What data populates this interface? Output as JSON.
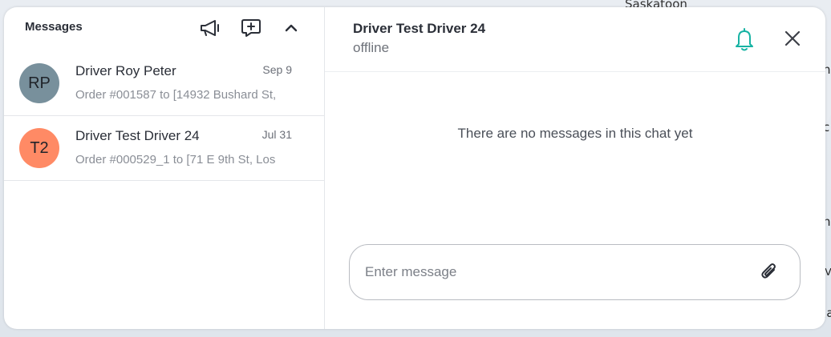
{
  "map": {
    "city_label": "Saskatoon",
    "edge_glyphs": [
      "h",
      "c",
      "hi",
      "M",
      "Ja"
    ]
  },
  "messages_panel": {
    "title": "Messages",
    "icons": {
      "broadcast": "megaphone-icon",
      "new_chat": "new-chat-icon",
      "collapse": "chevron-up-icon"
    },
    "conversations": [
      {
        "initials": "RP",
        "avatar_color": "#78909c",
        "name": "Driver Roy Peter",
        "date": "Sep 9",
        "preview": "Order #001587 to [14932 Bushard St,"
      },
      {
        "initials": "T2",
        "avatar_color": "#ff8a65",
        "name": "Driver Test Driver 24",
        "date": "Jul 31",
        "preview": "Order #000529_1 to [71 E 9th St, Los"
      }
    ]
  },
  "chat": {
    "name": "Driver Test Driver 24",
    "status": "offline",
    "empty_text": "There are no messages in this chat yet",
    "input_placeholder": "Enter message",
    "accent_color": "#17b3a3"
  }
}
